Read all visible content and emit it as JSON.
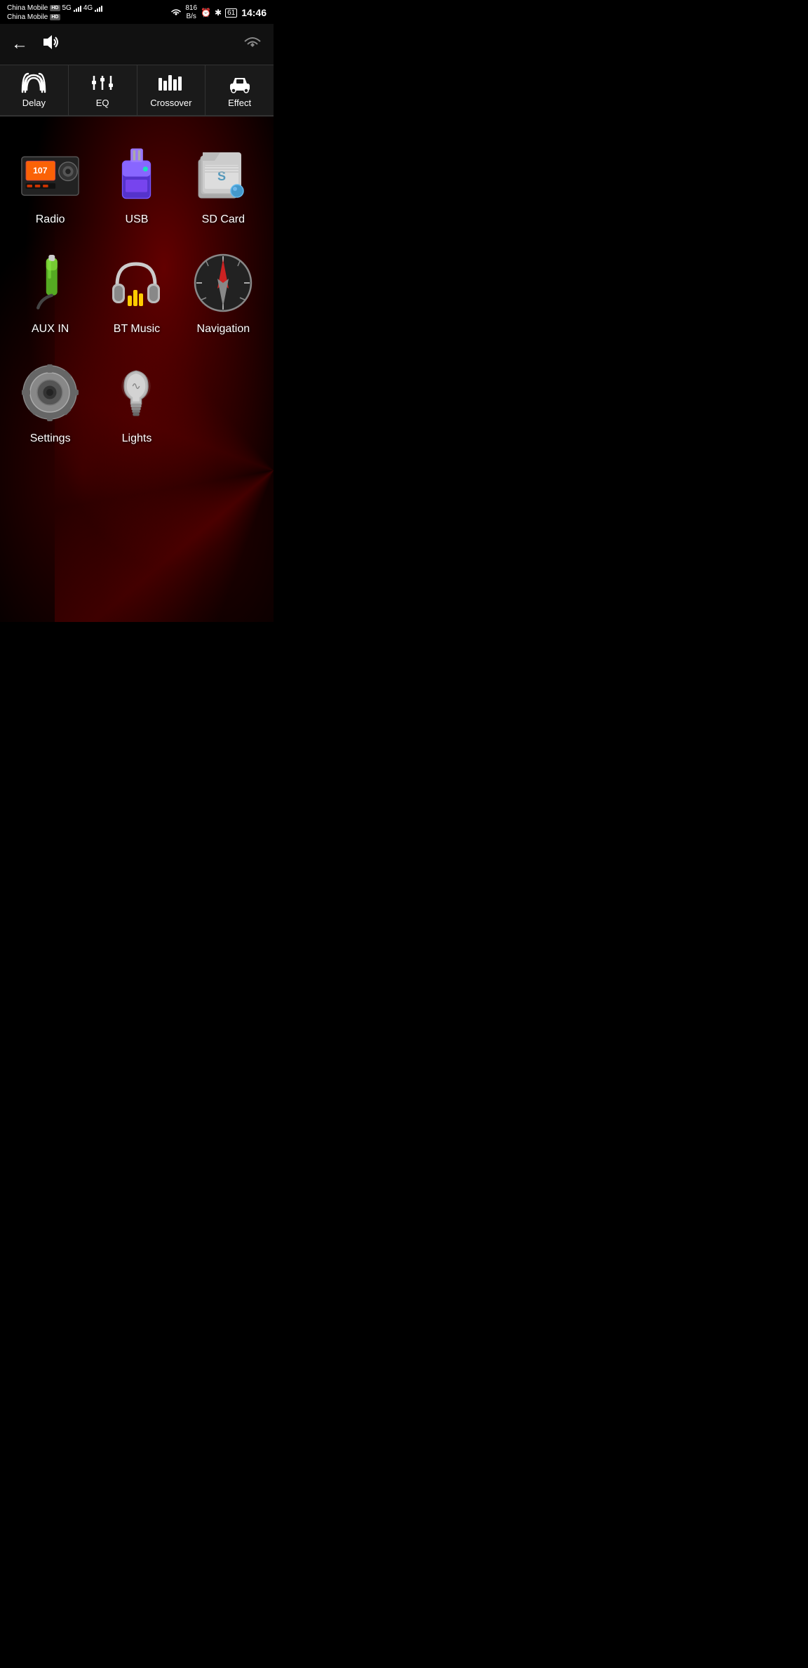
{
  "statusBar": {
    "carrier1": "China Mobile",
    "carrier2": "China Mobile",
    "hd": "HD",
    "network": "5G",
    "network2": "4G",
    "speed": "816",
    "speedUnit": "B/s",
    "time": "14:46",
    "battery": "61"
  },
  "header": {
    "backIcon": "←",
    "volumeIcon": "🔊"
  },
  "tabs": [
    {
      "id": "delay",
      "label": "Delay",
      "icon": "delay"
    },
    {
      "id": "eq",
      "label": "EQ",
      "icon": "eq"
    },
    {
      "id": "crossover",
      "label": "Crossover",
      "icon": "crossover"
    },
    {
      "id": "effect",
      "label": "Effect",
      "icon": "effect"
    }
  ],
  "apps": [
    {
      "id": "radio",
      "label": "Radio"
    },
    {
      "id": "usb",
      "label": "USB"
    },
    {
      "id": "sdcard",
      "label": "SD Card"
    },
    {
      "id": "auxin",
      "label": "AUX IN"
    },
    {
      "id": "btmusic",
      "label": "BT Music"
    },
    {
      "id": "navigation",
      "label": "Navigation"
    },
    {
      "id": "settings",
      "label": "Settings"
    },
    {
      "id": "lights",
      "label": "Lights"
    }
  ]
}
